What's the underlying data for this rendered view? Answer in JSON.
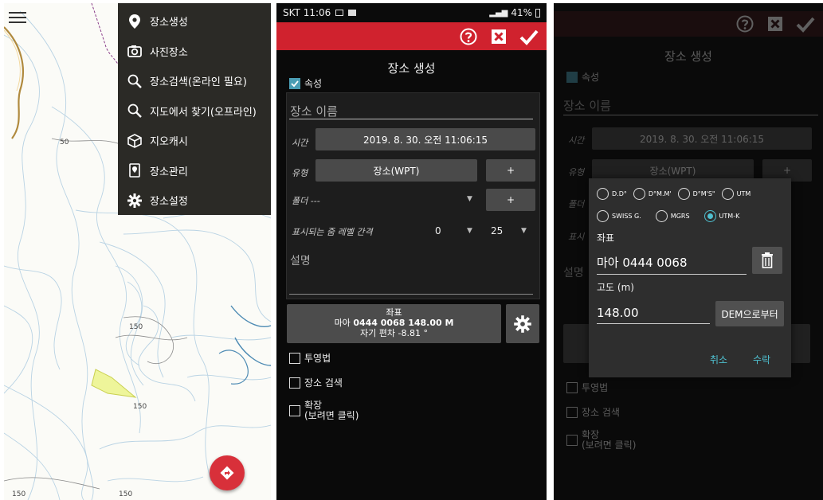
{
  "screen1": {
    "menu": [
      {
        "label": "장소생성",
        "icon": "map-pin-icon"
      },
      {
        "label": "사진장소",
        "icon": "camera-icon"
      },
      {
        "label": "장소검색(온라인 필요)",
        "icon": "search-icon"
      },
      {
        "label": "지도에서 찾기(오프라인)",
        "icon": "search-icon"
      },
      {
        "label": "지오캐시",
        "icon": "geocache-box-icon"
      },
      {
        "label": "장소관리",
        "icon": "place-manage-icon"
      },
      {
        "label": "장소설정",
        "icon": "gear-icon"
      }
    ],
    "map_labels": [
      "50",
      "150",
      "150",
      "150",
      "150"
    ]
  },
  "screen2": {
    "status": {
      "time": "SKT 11:06",
      "battery": "41%"
    },
    "title": "장소 생성",
    "attr_label": "속성",
    "name_placeholder": "장소 이름",
    "time_label": "시간",
    "time_value": "2019. 8. 30. 오전 11:06:15",
    "type_label": "유형",
    "type_value": "장소(WPT)",
    "plus": "+",
    "folder_label": "폴더",
    "folder_value": "---",
    "zoom_label": "표시되는 줌 레벨 간격",
    "zoom_min": "0",
    "zoom_max": "25",
    "desc_label": "설명",
    "coord_title": "좌표",
    "coord_prefix": "마아 ",
    "coord_value": "0444 0068 148.00 M",
    "declination": "자기 편차 -8.81 °",
    "checks": [
      "투영법",
      "장소 검색",
      "확장\n(보려면 클릭)"
    ]
  },
  "screen3": {
    "title": "장소 생성",
    "attr_label": "속성",
    "name_placeholder": "장소 이름",
    "time_label": "시간",
    "time_value": "2019. 8. 30. 오전 11:06:15",
    "type_label": "유형",
    "type_value": "장소(WPT)",
    "folder_label": "폴더",
    "zoom_label_short": "표시",
    "desc_label_short": "설명",
    "checks": [
      "투영법",
      "장소 검색",
      "확장\n(보려면 클릭)"
    ],
    "dialog": {
      "formats_row1": [
        "D.D°",
        "D°M.M'",
        "D°M'S\"",
        "UTM"
      ],
      "formats_row2": [
        "SWISS G.",
        "MGRS",
        "UTM-K"
      ],
      "selected": "UTM-K",
      "coord_label": "좌표",
      "coord_value": "마아 0444 0068",
      "alt_label": "고도 (m)",
      "alt_value": "148.00",
      "dem_button": "DEM으로부터",
      "cancel": "취소",
      "accept": "수락"
    }
  },
  "colors": {
    "toolbar_red": "#d0222e",
    "accent_teal": "#4fc0d0",
    "checkbox_blue": "#4a9db4"
  }
}
